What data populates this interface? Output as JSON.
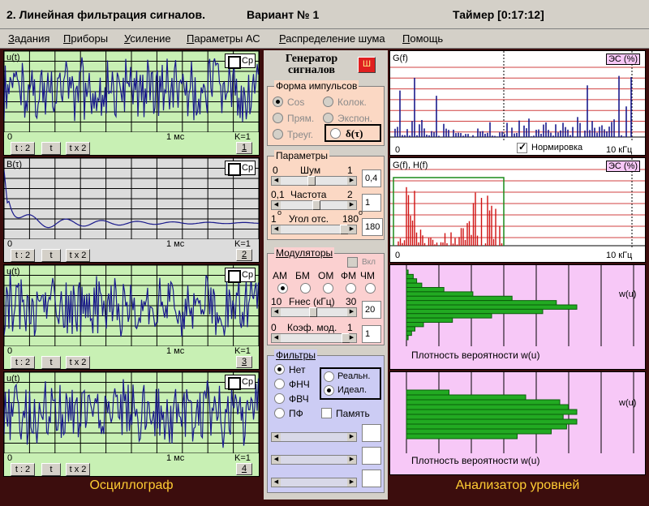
{
  "window": {
    "title": "2. Линейная фильтрация сигналов.",
    "variant": "Вариант № 1",
    "timer": "Таймер [0:17:12]"
  },
  "menu": [
    "Задания",
    "Приборы",
    "Усиление",
    "Параметры АС",
    "Распределение шума",
    "Помощь"
  ],
  "oscilloscope": {
    "footer": "Осциллограф",
    "channels": [
      {
        "label": "u(t)",
        "cp": "Cp",
        "x_start": "0",
        "x_mid": "1 мс",
        "k": "K=1",
        "buttons": [
          "t : 2",
          "t",
          "t x 2"
        ],
        "num": "1",
        "bg": "#c8f0b4"
      },
      {
        "label": "B(τ)",
        "cp": "Cp",
        "x_start": "0",
        "x_mid": "1 мс",
        "k": "K=1",
        "buttons": [
          "t : 2",
          "t",
          "t x 2"
        ],
        "num": "2",
        "bg": "#dcdcdc"
      },
      {
        "label": "u(t)",
        "cp": "Cp",
        "x_start": "0",
        "x_mid": "1 мс",
        "k": "K=1",
        "buttons": [
          "t : 2",
          "t",
          "t x 2"
        ],
        "num": "3",
        "bg": "#c8f0b4"
      },
      {
        "label": "u(t)",
        "cp": "Cp",
        "x_start": "0",
        "x_mid": "1 мс",
        "k": "K=1",
        "buttons": [
          "t : 2",
          "t",
          "t x 2"
        ],
        "num": "4",
        "bg": "#c8f0b4"
      }
    ]
  },
  "generator": {
    "title_line1": "Генератор",
    "title_line2": "сигналов",
    "power_label": "Ш",
    "pulse_group": "Форма импульсов",
    "pulse_options": [
      "Cos",
      "Колок.",
      "Прям.",
      "Экспон.",
      "Треуг.",
      "δ(τ)"
    ],
    "params_group": "Параметры",
    "noise": {
      "min": "0",
      "label": "Шум",
      "max": "1",
      "value": "0,4"
    },
    "freq": {
      "min": "0,1",
      "label": "Частота",
      "max": "2",
      "value": "1"
    },
    "angle": {
      "min": "1",
      "label": "Угол отс.",
      "max": "180",
      "unit": "o",
      "value": "180"
    },
    "modulators_group": "Модуляторы",
    "mod_enable": "Вкл",
    "mod_options": [
      "АМ",
      "БМ",
      "ОМ",
      "ФМ",
      "ЧМ"
    ],
    "fnes": {
      "min": "10",
      "label": "Fнес (кГц)",
      "max": "30",
      "value": "20"
    },
    "kmod": {
      "min": "0",
      "label": "Коэф. мод.",
      "max": "1",
      "value": "1"
    },
    "filters_group": "Фильтры",
    "filter_options": [
      "Нет",
      "ФНЧ",
      "ФВЧ",
      "ПФ"
    ],
    "filter_mode": [
      "Реальн.",
      "Идеал."
    ],
    "memory": "Память"
  },
  "spectrum": {
    "top": {
      "label": "G(f)",
      "es": "ЭС (%)",
      "x_start": "0",
      "x_end": "10 кГц",
      "normalize": "Нормировка"
    },
    "bottom": {
      "label": "G(f), H(f)",
      "es": "ЭС (%)",
      "x_start": "0",
      "x_end": "10 кГц"
    }
  },
  "levels": {
    "footer": "Анализатор уровней",
    "top": {
      "wlabel": "w(u)",
      "caption": "Плотность вероятности w(u)",
      "bars": [
        0.01,
        0.04,
        0.06,
        0.09,
        0.22,
        0.39,
        0.62,
        0.88,
        1.0,
        0.8,
        0.5,
        0.27,
        0.1,
        0.05,
        0.03,
        0.01
      ]
    },
    "bottom": {
      "wlabel": "w(u)",
      "caption": "Плотность вероятности w(u)",
      "bars": [
        0.25,
        0.7,
        0.9,
        0.95,
        1.0,
        0.92,
        1.0,
        0.94,
        0.85,
        0.65
      ]
    }
  },
  "colors": {
    "signal": "#1a1a8c",
    "spectrum": "#1a1a8c",
    "filtered": "#d01010",
    "filter_line": "#1a8c1a",
    "hist": "#22aa22",
    "grid": "#000000",
    "pink": "#f7c8f7"
  }
}
